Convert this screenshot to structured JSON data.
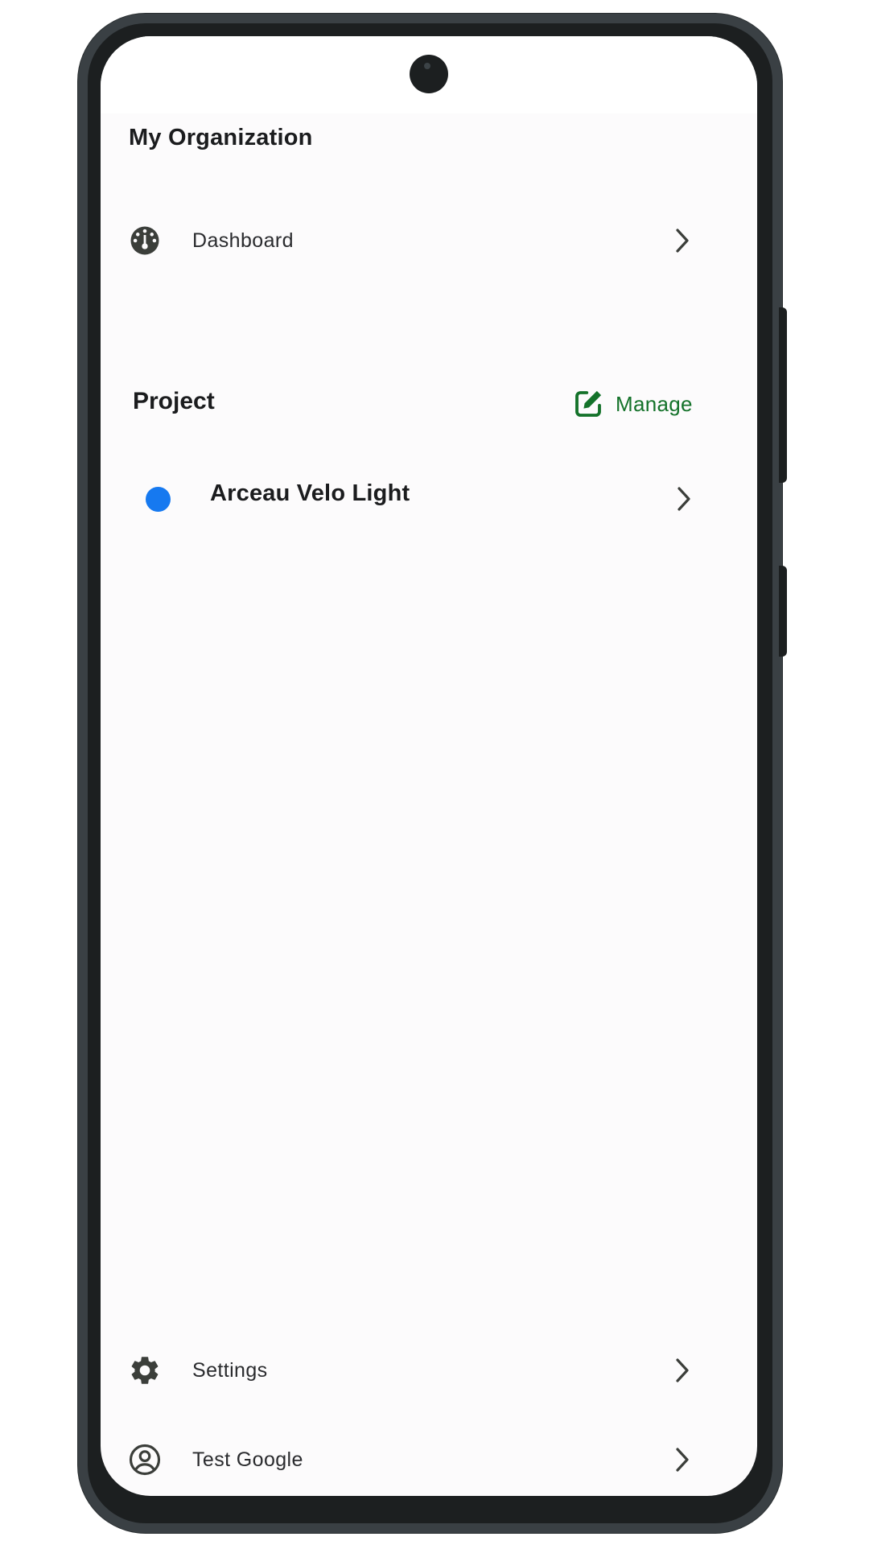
{
  "drawer": {
    "org_name": "My Organization",
    "dashboard": {
      "label": "Dashboard",
      "icon": "dashboard-gauge-icon"
    },
    "project_section": {
      "heading": "Project",
      "manage_label": "Manage",
      "manage_icon": "edit-icon"
    },
    "projects": [
      {
        "name": "Arceau Velo Light",
        "color": "#1679f0"
      }
    ],
    "settings": {
      "label": "Settings",
      "icon": "gear-icon"
    },
    "account": {
      "label": "Test Google",
      "icon": "account-circle-icon"
    }
  },
  "colors": {
    "accent_green": "#14722a",
    "icon_dark": "#3b3e3a",
    "background": "#fcfbfc"
  }
}
